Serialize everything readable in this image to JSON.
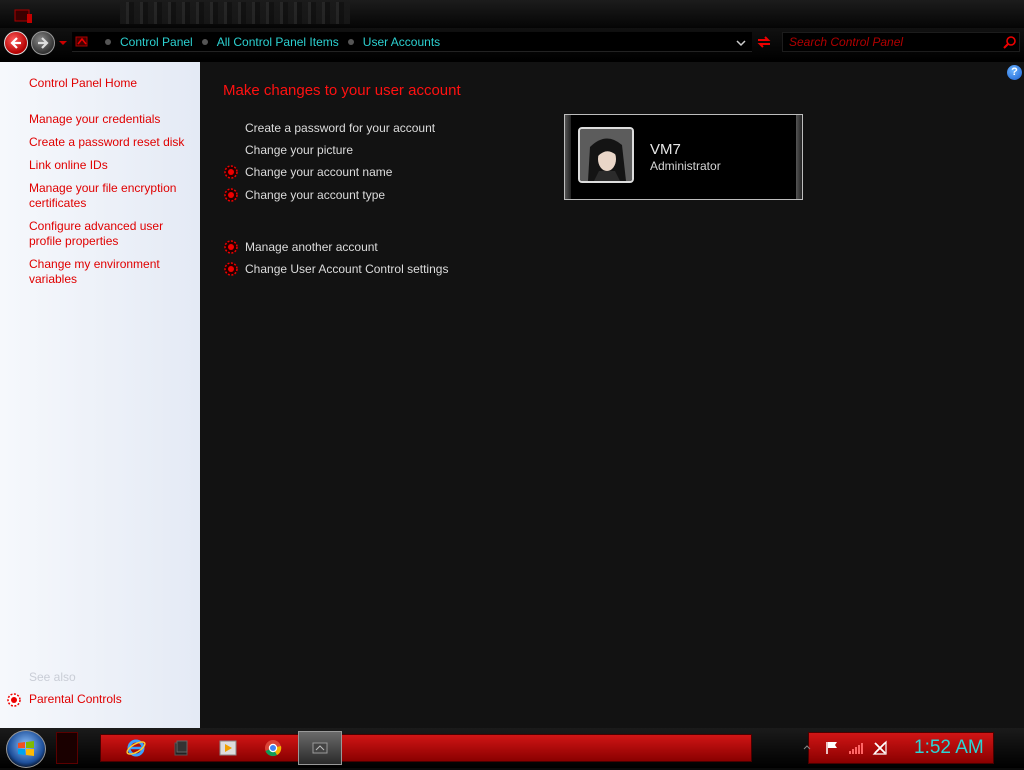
{
  "breadcrumbs": [
    "Control Panel",
    "All Control Panel Items",
    "User Accounts"
  ],
  "search": {
    "placeholder": "Search Control Panel"
  },
  "sidebar": {
    "home": "Control Panel Home",
    "links": [
      "Manage your credentials",
      "Create a password reset disk",
      "Link online IDs",
      "Manage your file encryption certificates",
      "Configure advanced user profile properties",
      "Change my environment variables"
    ],
    "see_also_label": "See also",
    "see_also_links": [
      "Parental Controls"
    ]
  },
  "main": {
    "title": "Make changes to your user account",
    "tasks": [
      "Create a password for your account",
      "Change your picture",
      "Change your account name",
      "Change your account type"
    ],
    "other_tasks": [
      "Manage another account",
      "Change User Account Control settings"
    ]
  },
  "user": {
    "name": "VM7",
    "role": "Administrator"
  },
  "help": {
    "label": "?"
  },
  "taskbar": {
    "clock": "1:52 AM",
    "pinned_icons": [
      "internet-explorer-icon",
      "windows-explorer-icon",
      "media-player-icon",
      "chrome-icon"
    ],
    "active_icon": "control-panel-icon",
    "tray_icons": [
      "action-center-flag-icon",
      "signal-strength-icon",
      "network-icon"
    ]
  },
  "colors": {
    "accent_red": "#e00000",
    "title_red": "#ff1111",
    "crumb_cyan": "#2cd0d0",
    "clock_cyan": "#2ad4d4",
    "content_bg": "#121212",
    "sidebar_bg": "#eef2f9"
  }
}
